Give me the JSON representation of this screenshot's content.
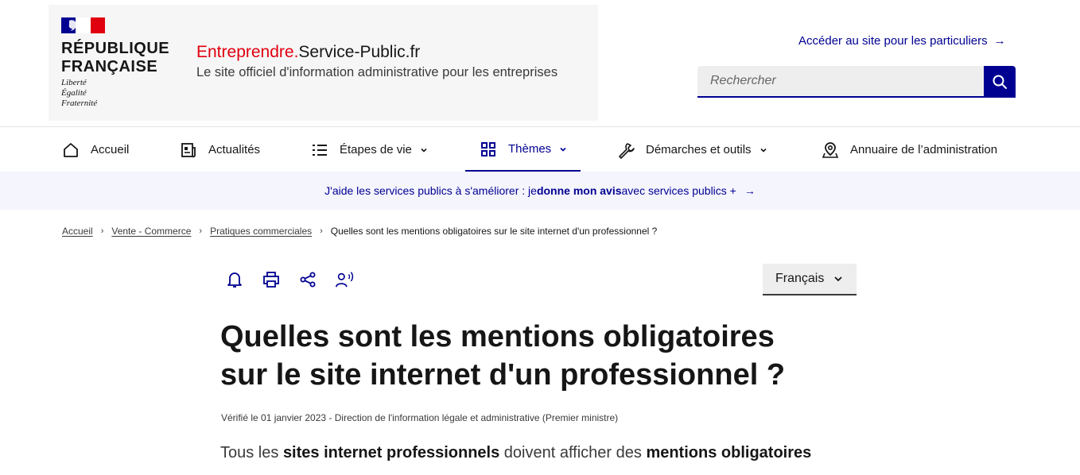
{
  "header": {
    "republic_line1": "RÉPUBLIQUE",
    "republic_line2": "FRANÇAISE",
    "devise": [
      "Liberté",
      "Égalité",
      "Fraternité"
    ],
    "site_name_accent": "Entreprendre.",
    "site_name_rest": "Service-Public.fr",
    "tagline": "Le site officiel d'information administrative pour les entreprises",
    "particuliers_link": "Accéder au site pour les particuliers",
    "search_placeholder": "Rechercher"
  },
  "nav": {
    "items": [
      {
        "label": "Accueil",
        "icon": "home-icon"
      },
      {
        "label": "Actualités",
        "icon": "newspaper-icon"
      },
      {
        "label": "Étapes de vie",
        "icon": "list-icon",
        "dropdown": true
      },
      {
        "label": "Thèmes",
        "icon": "grid-icon",
        "dropdown": true,
        "active": true
      },
      {
        "label": "Démarches et outils",
        "icon": "wrench-icon",
        "dropdown": true
      },
      {
        "label": "Annuaire de l’administration",
        "icon": "map-pin-icon"
      }
    ]
  },
  "banner": {
    "text_before": "J'aide les services publics à s'améliorer : je ",
    "text_bold": "donne mon avis",
    "text_after": " avec services publics +"
  },
  "breadcrumb": {
    "items": [
      "Accueil",
      "Vente - Commerce",
      "Pratiques commerciales"
    ],
    "current": "Quelles sont les mentions obligatoires sur le site internet d'un professionnel ?"
  },
  "tools": [
    "bell-icon",
    "print-icon",
    "share-icon",
    "listen-icon"
  ],
  "language": {
    "selected": "Français"
  },
  "article": {
    "title_line1": "Quelles sont les mentions obligatoires",
    "title_line2": "sur le site internet d'un professionnel ?",
    "verified": "Vérifié le 01 janvier 2023 - Direction de l'information légale et administrative (Premier ministre)",
    "intro_1": "Tous les ",
    "intro_b1": "sites internet professionnels",
    "intro_2": " doivent afficher des ",
    "intro_b2": "mentions obligatoires"
  },
  "colors": {
    "primary": "#000091",
    "accent": "#e1000f",
    "banner_bg": "#f5f5fe"
  }
}
